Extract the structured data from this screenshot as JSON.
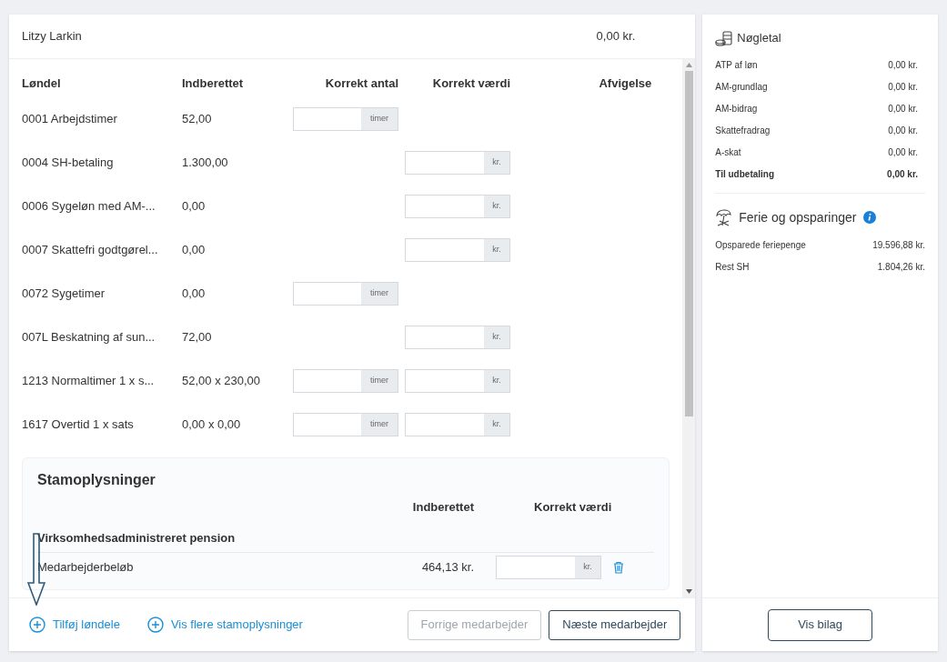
{
  "employee": {
    "name": "Litzy Larkin",
    "amount": "0,00 kr."
  },
  "table": {
    "columns": [
      "Løndel",
      "Indberettet",
      "Korrekt antal",
      "Korrekt værdi",
      "Afvigelse"
    ],
    "rows": [
      {
        "name": "0001 Arbejdstimer",
        "reported": "52,00",
        "count_unit": "timer"
      },
      {
        "name": "0004 SH-betaling",
        "reported": "1.300,00",
        "value_unit": "kr."
      },
      {
        "name": "0006 Sygeløn med AM-...",
        "reported": "0,00",
        "value_unit": "kr."
      },
      {
        "name": "0007 Skattefri godtgørel...",
        "reported": "0,00",
        "value_unit": "kr."
      },
      {
        "name": "0072 Sygetimer",
        "reported": "0,00",
        "count_unit": "timer"
      },
      {
        "name": "007L Beskatning af sun...",
        "reported": "72,00",
        "value_unit": "kr."
      },
      {
        "name": "1213 Normaltimer 1 x s...",
        "reported": "52,00 x 230,00",
        "count_unit": "timer",
        "value_unit": "kr."
      },
      {
        "name": "1617 Overtid 1 x sats",
        "reported": "0,00 x 0,00",
        "count_unit": "timer",
        "value_unit": "kr."
      }
    ]
  },
  "master_data": {
    "title": "Stamoplysninger",
    "columns": [
      "Indberettet",
      "Korrekt værdi"
    ],
    "group": "Virksomhedsadministreret pension",
    "rows": [
      {
        "label": "Medarbejderbeløb",
        "reported": "464,13 kr.",
        "unit": "kr."
      }
    ]
  },
  "footer": {
    "links": [
      "Tilføj løndele",
      "Vis flere stamoplysninger"
    ],
    "buttons": [
      {
        "label": "Forrige medarbejder",
        "disabled": true
      },
      {
        "label": "Næste medarbejder",
        "disabled": false
      }
    ]
  },
  "key_figures": {
    "title": "Nøgletal",
    "rows": [
      {
        "label": "ATP af løn",
        "value": "0,00 kr.",
        "bold": false
      },
      {
        "label": "AM-grundlag",
        "value": "0,00 kr.",
        "bold": false
      },
      {
        "label": "AM-bidrag",
        "value": "0,00 kr.",
        "bold": false
      },
      {
        "label": "Skattefradrag",
        "value": "0,00 kr.",
        "bold": false
      },
      {
        "label": "A-skat",
        "value": "0,00 kr.",
        "bold": false
      },
      {
        "label": "Til udbetaling",
        "value": "0,00 kr.",
        "bold": true
      }
    ]
  },
  "savings": {
    "title": "Ferie og opsparinger",
    "rows": [
      {
        "label": "Opsparede feriepenge",
        "value": "19.596,88 kr."
      },
      {
        "label": "Rest SH",
        "value": "1.804,26 kr."
      }
    ]
  },
  "voucher_button": "Vis bilag"
}
